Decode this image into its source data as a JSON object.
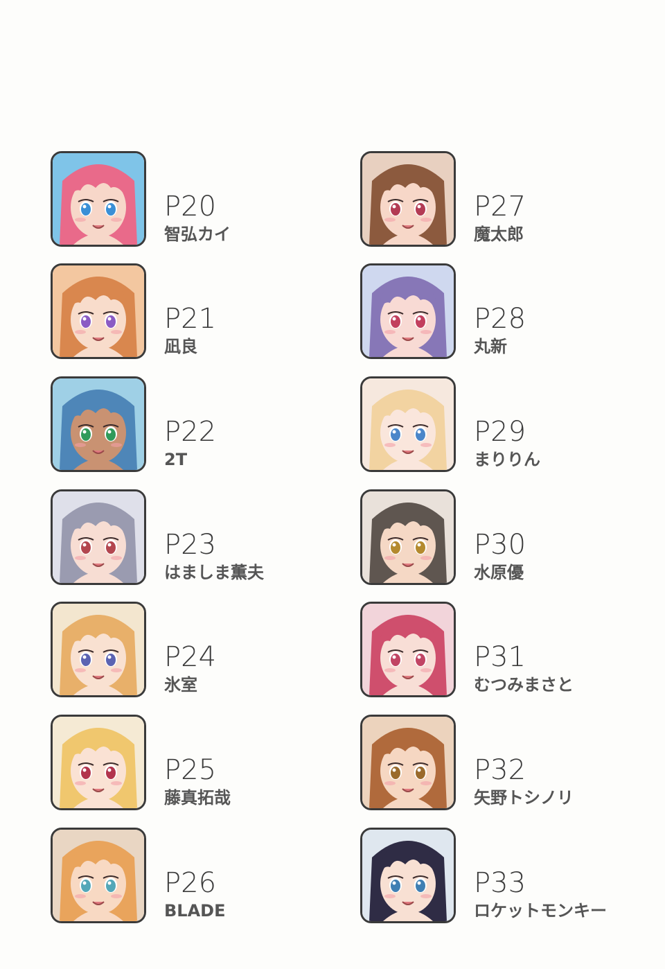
{
  "colors": {
    "background": "#fdfdfb",
    "page_number": "#3b3b3b",
    "artist_name": "#555555",
    "frame": "#3a3a3a"
  },
  "left_column": [
    {
      "page": "P20",
      "artist": "智弘カイ",
      "hair": "#e96a8a",
      "skin": "#f7d7c9",
      "eyes": "#3a8fd6",
      "bg": "#7fc4e8"
    },
    {
      "page": "P21",
      "artist": "凪良",
      "hair": "#d9874e",
      "skin": "#f8dccb",
      "eyes": "#8a5bc4",
      "bg": "#f3c7a0"
    },
    {
      "page": "P22",
      "artist": "2T",
      "hair": "#4e86b8",
      "skin": "#c99272",
      "eyes": "#2f9a5a",
      "bg": "#9fd0e6"
    },
    {
      "page": "P23",
      "artist": "はましま薫夫",
      "hair": "#9a9bb0",
      "skin": "#f7ddd3",
      "eyes": "#b3464f",
      "bg": "#dfe0ea"
    },
    {
      "page": "P24",
      "artist": "氷室",
      "hair": "#e8b06a",
      "skin": "#f9e1d1",
      "eyes": "#5b63b2",
      "bg": "#f3e6cf"
    },
    {
      "page": "P25",
      "artist": "藤真拓哉",
      "hair": "#f0c76e",
      "skin": "#fae2d4",
      "eyes": "#b2344d",
      "bg": "#f5ead4"
    },
    {
      "page": "P26",
      "artist": "BLADE",
      "hair": "#e9a45c",
      "skin": "#f8d9c3",
      "eyes": "#53a7b8",
      "bg": "#e9d6c3"
    }
  ],
  "right_column": [
    {
      "page": "P27",
      "artist": "魔太郎",
      "hair": "#8c5a3e",
      "skin": "#f7d7c8",
      "eyes": "#b33b54",
      "bg": "#e8d0c0"
    },
    {
      "page": "P28",
      "artist": "丸新",
      "hair": "#8777b7",
      "skin": "#f8dad4",
      "eyes": "#c23f5e",
      "bg": "#cfd8ef"
    },
    {
      "page": "P29",
      "artist": "まりりん",
      "hair": "#f2d3a1",
      "skin": "#fae6dc",
      "eyes": "#4a86c9",
      "bg": "#f6e8de"
    },
    {
      "page": "P30",
      "artist": "水原優",
      "hair": "#5f5650",
      "skin": "#f5d8c5",
      "eyes": "#b48a2e",
      "bg": "#e9e1da"
    },
    {
      "page": "P31",
      "artist": "むつみまさと",
      "hair": "#cf4f6d",
      "skin": "#f8ded6",
      "eyes": "#c14564",
      "bg": "#f2d4da"
    },
    {
      "page": "P32",
      "artist": "矢野トシノリ",
      "hair": "#b06a3c",
      "skin": "#f6d7c2",
      "eyes": "#9a6a2c",
      "bg": "#ecd3bd"
    },
    {
      "page": "P33",
      "artist": "ロケットモンキー",
      "hair": "#2f2c45",
      "skin": "#f8e0d3",
      "eyes": "#3f7fb3",
      "bg": "#dfe7ef"
    }
  ]
}
